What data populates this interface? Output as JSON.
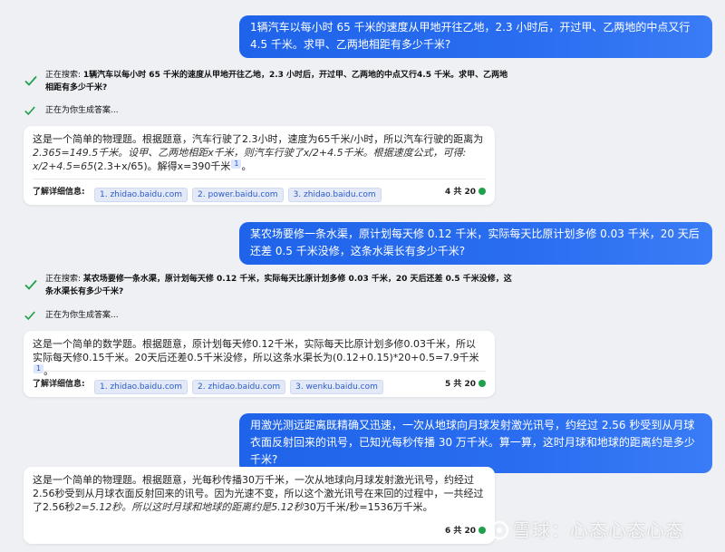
{
  "conversation": {
    "q1": "1辆汽车以每小时 65 千米的速度从甲地开往乙地，2.3 小时后，开过甲、乙两地的中点又行4.5 千米。求甲、乙两地相距有多少千米?",
    "s1_prefix": "正在搜索: ",
    "s1_query": "1辆汽车以每小时 65 千米的速度从甲地开往乙地，2.3 小时后，开过甲、乙两地的中点又行4.5 千米。求甲、乙两地相距有多少千米?",
    "gen1": "正在为你生成答案...",
    "a1_normal": "这是一个简单的物理题。根据题意，汽车行驶了2.3小时，速度为65千米/小时，所以汽车行驶的距离为",
    "a1_italic": "2.365=149.5千米。设甲、乙两地相距x千米，则汽车行驶了x/2+4.5千米。根据速度公式，可得: x/2+4.5=65",
    "a1_tail": "(2.3+x/65)。解得x=390千米",
    "a1_cite": "1",
    "a1_end": "。",
    "refs_label": "了解详细信息:",
    "a1_refs": [
      "1. zhidao.baidu.com",
      "2. power.baidu.com",
      "3. zhidao.baidu.com"
    ],
    "a1_count": "4 共 20",
    "q2": "某农场要修一条水渠，原计划每天修 0.12 千米，实际每天比原计划多修 0.03 千米，20 天后还差 0.5 千米没修，这条水渠长有多少千米?",
    "s2_prefix": "正在搜索: ",
    "s2_query": "某农场要修一条水渠，原计划每天修 0.12 千米，实际每天比原计划多修 0.03 千米，20 天后还差 0.5 千米没修，这条水渠长有多少千米?",
    "gen2": "正在为你生成答案...",
    "a2_text": "这是一个简单的数学题。根据题意，原计划每天修0.12千米，实际每天比原计划多修0.03千米，所以实际每天修0.15千米。20天后还差0.5千米没修，所以这条水渠长为(0.12+0.15)*20+0.5=7.9千米",
    "a2_cite": "1",
    "a2_end": "。",
    "a2_refs": [
      "1. zhidao.baidu.com",
      "2. zhidao.baidu.com",
      "3. wenku.baidu.com"
    ],
    "a2_count": "5 共 20",
    "q3": "用激光测远距离既精确又迅速，一次从地球向月球发射激光讯号，约经过 2.56 秒受到从月球衣面反射回来的讯号，已知光每秒传播 30 万千米。算一算，这时月球和地球的距离约是多少千米?",
    "a3_normal": "这是一个简单的物理题。根据题意，光每秒传播30万千米，一次从地球向月球发射激光讯号，约经过2.56秒受到从月球衣面反射回来的讯号。因为光速不变，所以这个激光讯号在来回的过程中，一共经过了2.56秒",
    "a3_italic": "2=5.12秒。所以这时月球和地球的距离约是5.12秒",
    "a3_tail": "30万千米/秒=1536万千米。",
    "a3_count": "6 共 20"
  },
  "watermark": "雪球：心态心态心态",
  "colors": {
    "accent": "#1e63e9",
    "check": "#1fa14b",
    "bg": "#eef0f4"
  }
}
